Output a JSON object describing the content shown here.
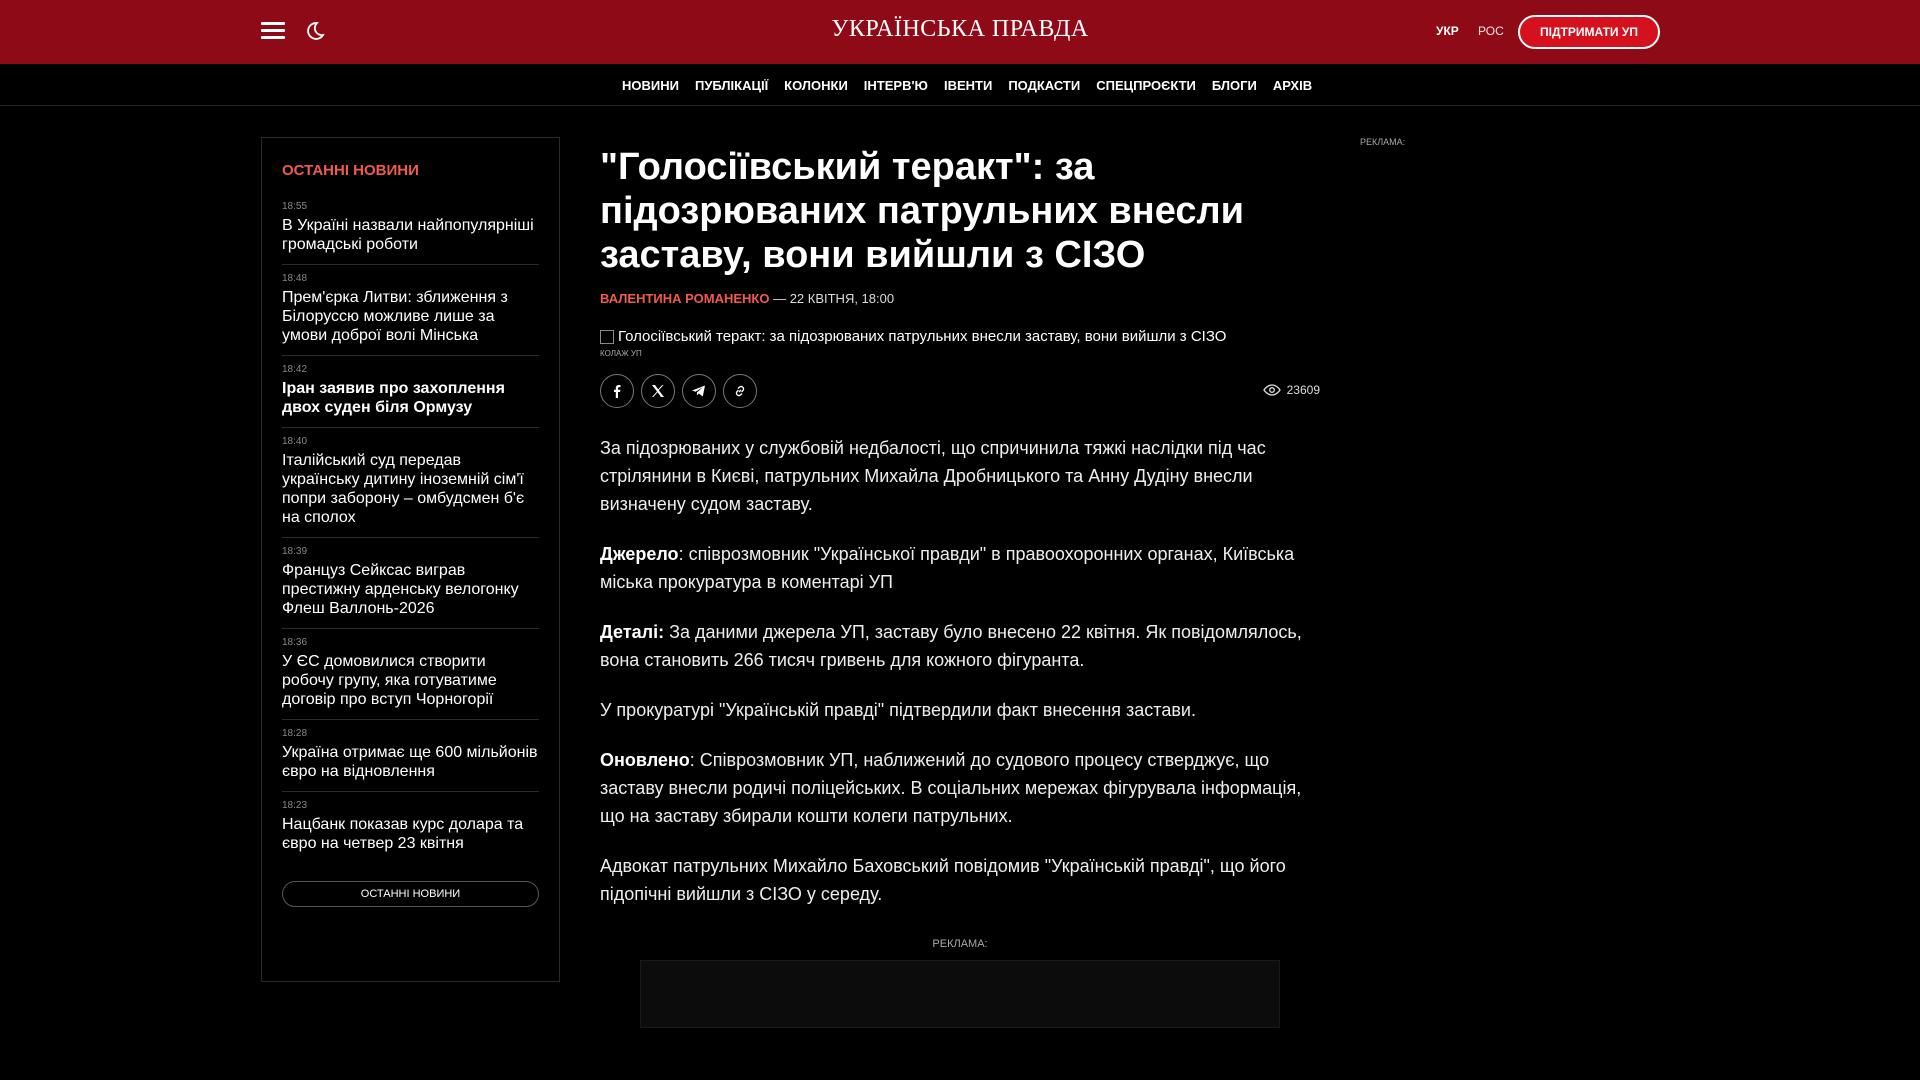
{
  "header": {
    "logo": "УКРАЇНСЬКА ПРАВДА",
    "lang_ukr": "УКР",
    "lang_ros": "РОС",
    "support": "ПІДТРИМАТИ УП"
  },
  "nav": [
    "НОВИНИ",
    "ПУБЛІКАЦІЇ",
    "КОЛОНКИ",
    "ІНТЕРВ'Ю",
    "ІВЕНТИ",
    "ПОДКАСТИ",
    "СПЕЦПРОЄКТИ",
    "БЛОГИ",
    "АРХІВ"
  ],
  "sidebar": {
    "title": "ОСТАННІ НОВИНИ",
    "items": [
      {
        "time": "18:55",
        "text": "В Україні назвали найпопулярніші громадські роботи"
      },
      {
        "time": "18:48",
        "text": "Прем'єрка Литви: зближення з Білоруссю можливе лише за умови доброї волі Мінська"
      },
      {
        "time": "18:42",
        "text": "Іран заявив про захоплення двох суден біля Ормузу"
      },
      {
        "time": "18:40",
        "text": "Італійський суд передав українську дитину іноземній сім'ї попри заборону – омбудсмен б'є на сполох"
      },
      {
        "time": "18:39",
        "text": "Француз Сейксас виграв престижну арденську велогонку Флеш Валлонь-2026"
      },
      {
        "time": "18:36",
        "text": "У ЄС домовилися створити робочу групу, яка готуватиме договір про вступ Чорногорії"
      },
      {
        "time": "18:28",
        "text": "Україна отримає ще 600 мільйонів євро на відновлення"
      },
      {
        "time": "18:23",
        "text": "Нацбанк показав курс долара та євро на четвер 23 квітня"
      }
    ],
    "more": "ОСТАННІ НОВИНИ"
  },
  "article": {
    "headline": "\"Голосіївський теракт\": за підозрюваних патрульних внесли заставу, вони вийшли з СІЗО",
    "author": "ВАЛЕНТИНА РОМАНЕНКО",
    "date": " — 22 КВІТНЯ, 18:00",
    "image_alt": "Голосіївський теракт: за підозрюваних патрульних внесли заставу, вони вийшли з СІЗО",
    "image_credit": "КОЛАЖ УП",
    "views": "23609",
    "p1": "За підозрюваних у службовій недбалості, що спричинила тяжкі наслідки під час стрілянини в Києві, патрульних Михайла Дробницького та Анну Дудіну внесли визначену судом заставу.",
    "p2_label": "Джерело",
    "p2": ": співрозмовник \"Української правди\" в правоохоронних органах, Київська міська прокуратура в коментарі УП",
    "p3_label": "Деталі:",
    "p3": " За даними джерела УП, заставу було внесено 22 квітня. Як повідомлялось, вона становить 266 тисяч гривень для кожного фігуранта.",
    "p4": "У прокуратурі \"Українській правді\" підтвердили факт внесення застави.",
    "p5_label": "Оновлено",
    "p5": ": Співрозмовник УП, наближений до судового процесу стверджує, що заставу внесли родичі поліцейських. В соціальних мережах фігурувала інформація, що на заставу збирали кошти колеги патрульних.",
    "p6": "Адвокат патрульних Михайло Баховський повідомив \"Українській правді\", що його підопічні вийшли з СІЗО у середу.",
    "ad_label": "РЕКЛАМА:"
  },
  "right_ad_label": "РЕКЛАМА:",
  "colors": {
    "brand": "#8f0a17",
    "accent": "#f05a4f",
    "button": "#d6111f"
  },
  "icons": [
    "menu-icon",
    "moon-icon",
    "facebook-icon",
    "x-icon",
    "telegram-icon",
    "link-icon",
    "eye-icon"
  ]
}
